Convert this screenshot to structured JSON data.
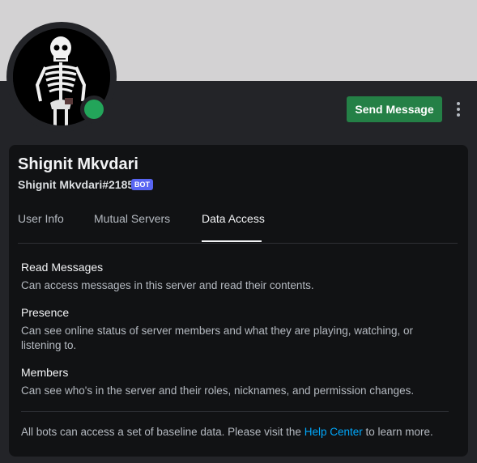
{
  "profile": {
    "display_name": "Shignit Mkvdari",
    "tag": "Shignit Mkvdari#2185",
    "badge": "BOT",
    "status": "online",
    "status_color": "#23a55a",
    "banner_color": "#d3d2d3",
    "avatar_icon": "skeleton-avatar"
  },
  "actions": {
    "send_message": "Send Message",
    "more_icon": "vertical-ellipsis-icon"
  },
  "tabs": [
    {
      "label": "User Info",
      "active": false
    },
    {
      "label": "Mutual Servers",
      "active": false
    },
    {
      "label": "Data Access",
      "active": true
    }
  ],
  "permissions": [
    {
      "title": "Read Messages",
      "description": "Can access messages in this server and read their contents."
    },
    {
      "title": "Presence",
      "description": "Can see online status of server members and what they are playing, watching, or listening to."
    },
    {
      "title": "Members",
      "description": "Can see who's in the server and their roles, nicknames, and permission changes."
    }
  ],
  "footer": {
    "before": "All bots can access a set of baseline data. Please visit the ",
    "link": "Help Center",
    "after": " to learn more."
  },
  "colors": {
    "accent_button": "#248046",
    "link": "#00a8fc",
    "badge": "#5865f2"
  }
}
